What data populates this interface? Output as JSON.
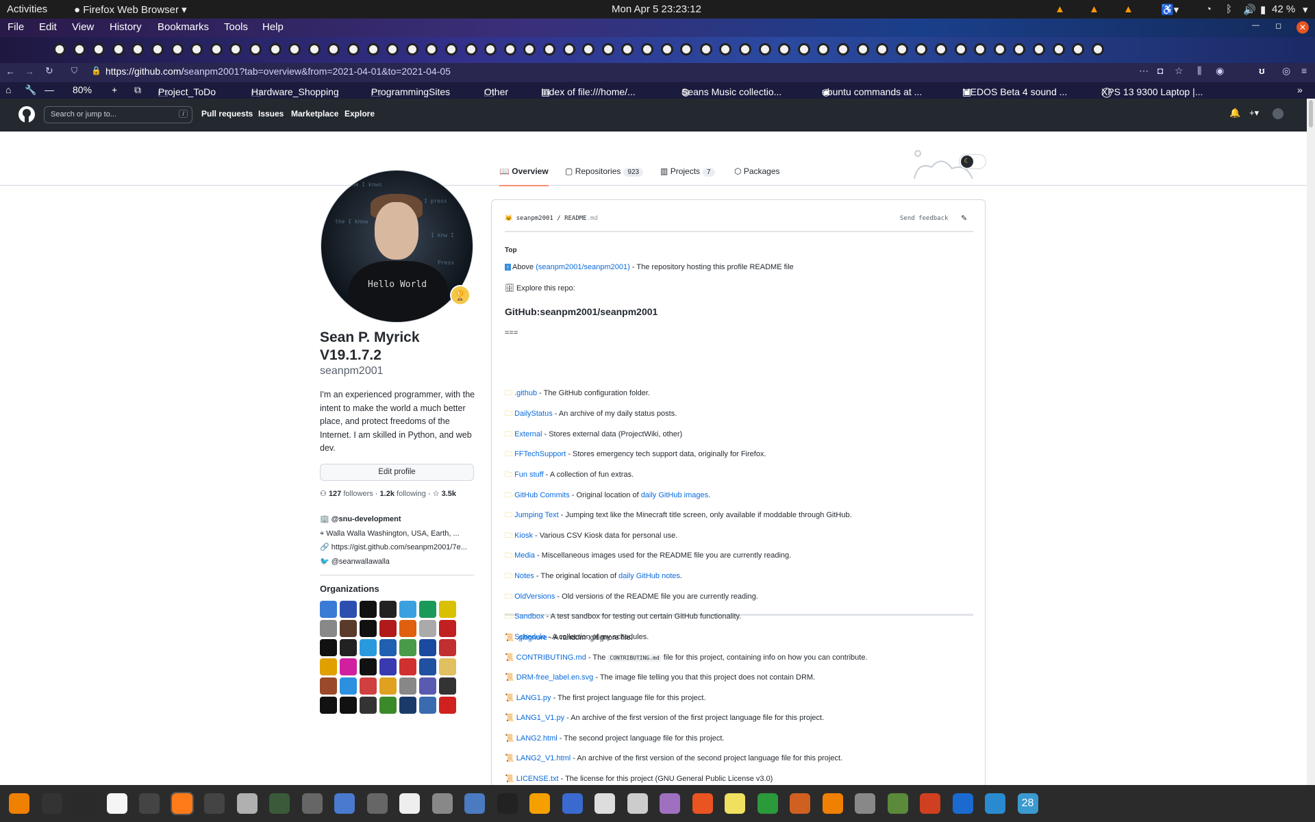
{
  "topbar": {
    "activities": "Activities",
    "app": "Firefox Web Browser",
    "clock": "Mon Apr 5  23:23:12",
    "battery": "42 %"
  },
  "menu": {
    "items": [
      "File",
      "Edit",
      "View",
      "History",
      "Bookmarks",
      "Tools",
      "Help"
    ]
  },
  "nav": {
    "url_host": "https://github.com/",
    "url_path": "seanpm2001?tab=overview&from=2021-04-01&to=2021-04-05",
    "zoom": "80%"
  },
  "bookmarks": [
    {
      "label": "Project_ToDo"
    },
    {
      "label": "Hardware_Shopping"
    },
    {
      "label": "ProgrammingSites"
    },
    {
      "label": "Other"
    },
    {
      "label": "Index of file:///home/..."
    },
    {
      "label": "Seans Music collectio..."
    },
    {
      "label": "ubuntu commands at ..."
    },
    {
      "label": "MEDOS Beta 4 sound ..."
    },
    {
      "label": "XPS 13 9300 Laptop |..."
    }
  ],
  "gh": {
    "search_placeholder": "Search or jump to...",
    "search_key": "/",
    "nav": [
      "Pull requests",
      "Issues",
      "Marketplace",
      "Explore"
    ]
  },
  "profile_tabs": [
    {
      "label": "Overview"
    },
    {
      "label": "Repositories",
      "count": "923"
    },
    {
      "label": "Projects",
      "count": "7"
    },
    {
      "label": "Packages"
    }
  ],
  "avatar": {
    "shirt_text": "Hello World",
    "matrix": [
      "the I knwo",
      "I press",
      "the I know",
      "I knw I",
      "Press"
    ]
  },
  "profile": {
    "name_line1": "Sean P. Myrick",
    "name_line2": "V19.1.7.2",
    "login": "seanpm2001",
    "bio": "I'm an experienced programmer, with the intent to make the world a much better place, and protect freedoms of the Internet. I am skilled in Python, and web dev.",
    "edit": "Edit profile",
    "followers": "127",
    "followers_label": "followers",
    "following": "1.2k",
    "following_label": "following",
    "stars": "3.5k",
    "org": "@snu-development",
    "location": "Walla Walla Washington, USA, Earth, ...",
    "website": "https://gist.github.com/seanpm2001/7e...",
    "twitter": "@seanwallawalla",
    "orgs_title": "Organizations"
  },
  "readme": {
    "path_user": "seanpm2001",
    "path_sep": "/",
    "path_file": "README",
    "path_ext": ".md",
    "feedback": "Send feedback",
    "top": "Top",
    "above_pre": "Above",
    "above_link": "(seanpm2001/seanpm2001)",
    "above_post": "- The repository hosting this profile README file",
    "explore": "Explore this repo:",
    "heading": "GitHub:seanpm2001/seanpm2001",
    "sep": "===",
    "folders": [
      {
        "link": ".github",
        "desc": " - The GitHub configuration folder."
      },
      {
        "link": "DailyStatus",
        "desc": " - An archive of my daily status posts."
      },
      {
        "link": "External",
        "desc": " - Stores external data (ProjectWiki, other)"
      },
      {
        "link": "FFTechSupport",
        "desc": " - Stores emergency tech support data, originally for Firefox."
      },
      {
        "link": "Fun stuff",
        "desc": " - A collection of fun extras."
      },
      {
        "link": "GitHub Commits",
        "desc": " - Original location of ",
        "link2": "daily GitHub images",
        "desc2": "."
      },
      {
        "link": "Jumping Text",
        "desc": " - Jumping text like the Minecraft title screen, only available if moddable through GitHub."
      },
      {
        "link": "Kiosk",
        "desc": " - Various CSV Kiosk data for personal use."
      },
      {
        "link": "Media",
        "desc": " - Miscellaneous images used for the README file you are currently reading."
      },
      {
        "link": "Notes",
        "desc": " - The original location of ",
        "link2": "daily GitHub notes",
        "desc2": "."
      },
      {
        "link": "OldVersions",
        "desc": " - Old versions of the README file you are currently reading."
      },
      {
        "link": "Sandbox",
        "desc": " - A test sandbox for testing out certain GitHub functionality."
      },
      {
        "link": "Schedule",
        "desc": " - A collection of my schedules."
      }
    ],
    "files": [
      {
        "link": ".gitignore",
        "desc": " - A random .gitignore file."
      },
      {
        "link": "CONTRIBUTING.md",
        "desc": " - The ",
        "code": "CONTRIBUTING.md",
        "desc2": " file for this project, containing info on how you can contribute."
      },
      {
        "link": "DRM-free_label.en.svg",
        "desc": " - The image file telling you that this project does not contain DRM."
      },
      {
        "link": "LANG1.py",
        "desc": " - The first project language file for this project."
      },
      {
        "link": "LANG1_V1.py",
        "desc": " - An archive of the first version of the first project language file for this project."
      },
      {
        "link": "LANG2.html",
        "desc": " - The second project language file for this project."
      },
      {
        "link": "LANG2_V1.html",
        "desc": " - An archive of the first version of the second project language file for this project."
      },
      {
        "link": "LICENSE.txt",
        "desc": " - The license for this project (GNU General Public License v3.0)"
      }
    ]
  },
  "dock": {
    "calendar_day": "28"
  },
  "colors": {
    "link": "#0969da",
    "gh_header": "#24292f",
    "accent": "#fd8c73",
    "folder": "#f5b800"
  }
}
